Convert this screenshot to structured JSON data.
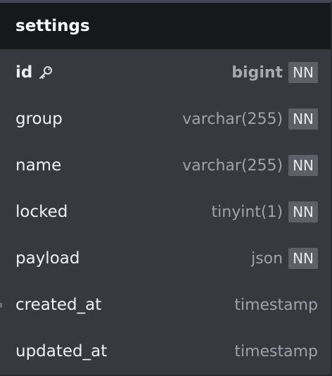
{
  "table": {
    "name": "settings",
    "columns": [
      {
        "name": "id",
        "type": "bigint",
        "nn": "NN",
        "primary_key": true,
        "icon": "key-icon"
      },
      {
        "name": "group",
        "type": "varchar(255)",
        "nn": "NN"
      },
      {
        "name": "name",
        "type": "varchar(255)",
        "nn": "NN"
      },
      {
        "name": "locked",
        "type": "tinyint(1)",
        "nn": "NN"
      },
      {
        "name": "payload",
        "type": "json",
        "nn": "NN"
      },
      {
        "name": "created_at",
        "type": "timestamp",
        "nn": ""
      },
      {
        "name": "updated_at",
        "type": "timestamp",
        "nn": ""
      }
    ]
  },
  "colors": {
    "header_bg": "#17181a",
    "body_bg": "#38393f",
    "badge_bg": "#5f6067",
    "name_text": "#eef0f2",
    "type_text": "#9ea2ab"
  }
}
